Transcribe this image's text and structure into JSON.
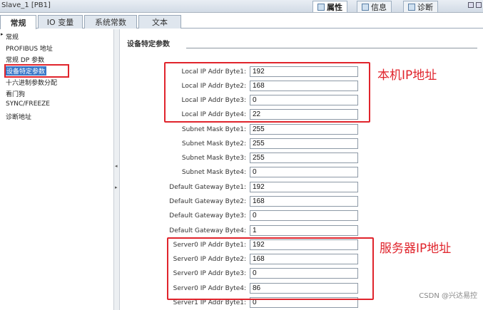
{
  "window": {
    "title": "Slave_1 [PB1]"
  },
  "panel_tabs": [
    {
      "label": "属性"
    },
    {
      "label": "信息"
    },
    {
      "label": "诊断"
    }
  ],
  "tabs": [
    {
      "label": "常规"
    },
    {
      "label": "IO 变量"
    },
    {
      "label": "系统常数"
    },
    {
      "label": "文本"
    }
  ],
  "nav": {
    "items": [
      {
        "label": "常规"
      },
      {
        "label": "PROFIBUS 地址"
      },
      {
        "label": "常规 DP 参数"
      },
      {
        "label": "设备特定参数"
      },
      {
        "label": "十六进制参数分配"
      },
      {
        "label": "看门狗"
      },
      {
        "label": "SYNC/FREEZE"
      },
      {
        "label": "诊断地址"
      }
    ],
    "selected_index": 3
  },
  "section": {
    "title": "设备特定参数"
  },
  "params": [
    {
      "label": "Local IP Addr Byte1:",
      "value": "192"
    },
    {
      "label": "Local IP Addr Byte2:",
      "value": "168"
    },
    {
      "label": "Local IP Addr Byte3:",
      "value": "0"
    },
    {
      "label": "Local IP Addr Byte4:",
      "value": "22"
    },
    {
      "label": "Subnet Mask Byte1:",
      "value": "255"
    },
    {
      "label": "Subnet Mask Byte2:",
      "value": "255"
    },
    {
      "label": "Subnet Mask Byte3:",
      "value": "255"
    },
    {
      "label": "Subnet Mask Byte4:",
      "value": "0"
    },
    {
      "label": "Default Gateway Byte1:",
      "value": "192"
    },
    {
      "label": "Default Gateway Byte2:",
      "value": "168"
    },
    {
      "label": "Default Gateway Byte3:",
      "value": "0"
    },
    {
      "label": "Default Gateway Byte4:",
      "value": "1"
    },
    {
      "label": "Server0 IP Addr Byte1:",
      "value": "192"
    },
    {
      "label": "Server0 IP Addr Byte2:",
      "value": "168"
    },
    {
      "label": "Server0 IP Addr Byte3:",
      "value": "0"
    },
    {
      "label": "Server0 IP Addr Byte4:",
      "value": "86"
    },
    {
      "label": "Server1 IP Addr Byte1:",
      "value": "0"
    }
  ],
  "annotations": {
    "local_ip": "本机IP地址",
    "server_ip": "服务器IP地址"
  },
  "watermark": "CSDN @兴达易控",
  "colors": {
    "highlight": "#e0242c",
    "selection": "#3a78c9"
  }
}
